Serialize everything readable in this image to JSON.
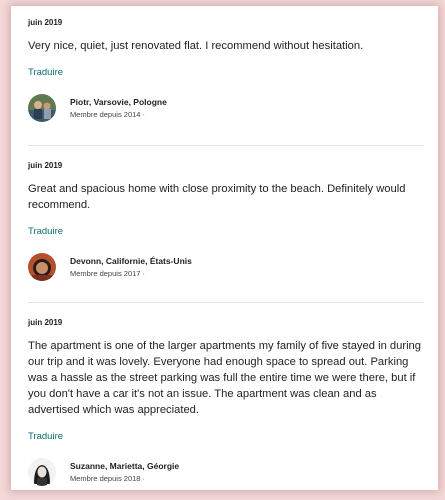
{
  "reviews": [
    {
      "date": "juin 2019",
      "text": "Very nice, quiet, just renovated flat. I recommend without hesitation.",
      "translate": "Traduire",
      "author": "Piotr, Varsovie, Pologne",
      "member_since": "Membre depuis 2014 ·"
    },
    {
      "date": "juin 2019",
      "text": "Great and spacious home with close proximity to the beach. Definitely would recommend.",
      "translate": "Traduire",
      "author": "Devonn, Californie, États-Unis",
      "member_since": "Membre depuis 2017 ·"
    },
    {
      "date": "juin 2019",
      "text": "The apartment is one of the larger apartments my family of five stayed in during our trip and it was lovely. Everyone had enough space to spread out. Parking was a hassle as the street parking was full the entire time we were there, but if you don't have a car it's not an issue. The apartment was clean and as advertised which was appreciated.",
      "translate": "Traduire",
      "author": "Suzanne, Marietta, Géorgie",
      "member_since": "Membre depuis 2018 ·"
    }
  ]
}
